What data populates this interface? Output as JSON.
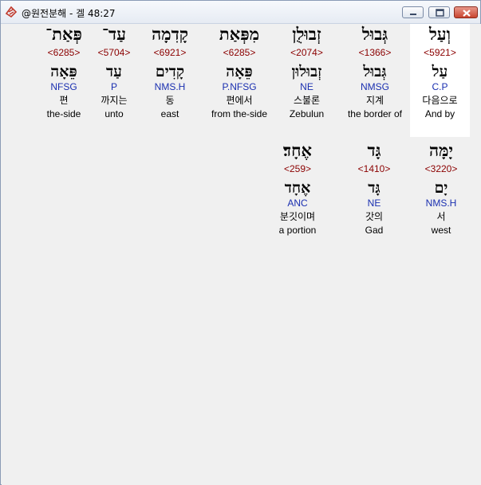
{
  "window": {
    "title": "@원전분해 - 겔 48:27",
    "icon": "app-logo-icon",
    "buttons": [
      "minimize-icon",
      "maximize-icon",
      "close-icon"
    ]
  },
  "colors": {
    "strong": "#8b0000",
    "morph": "#1a2fb0",
    "highlight_bg": "#ffffff",
    "content_bg": "#f0f0f0"
  },
  "words": [
    {
      "hebrew": "וְעַל",
      "strong": "<5921>",
      "lemma": "עַל",
      "morph": "C.P",
      "korean": "다음으로",
      "english": "And by"
    },
    {
      "hebrew": "גְּבוּל",
      "strong": "<1366>",
      "lemma": "גְּבוּל",
      "morph": "NMSG",
      "korean": "지계",
      "english": "the border of"
    },
    {
      "hebrew": "זְבוּלֻן",
      "strong": "<2074>",
      "lemma": "זְבוּלוּן",
      "morph": "NE",
      "korean": "스불론",
      "english": "Zebulun"
    },
    {
      "hebrew": "מִפְּאַת",
      "strong": "<6285>",
      "lemma": "פֵּאָה",
      "morph": "P.NFSG",
      "korean": "편에서",
      "english": "from the-side"
    },
    {
      "hebrew": "קָדִמָה",
      "strong": "<6921>",
      "lemma": "קָדִים",
      "morph": "NMS.H",
      "korean": "동",
      "english": "east"
    },
    {
      "hebrew": "עַד־",
      "strong": "<5704>",
      "lemma": "עַד",
      "morph": "P",
      "korean": "까지는",
      "english": "unto"
    },
    {
      "hebrew": "פְּאַת־",
      "strong": "<6285>",
      "lemma": "פֵּאָה",
      "morph": "NFSG",
      "korean": "편",
      "english": "the-side"
    },
    {
      "hebrew": "יָמָּה",
      "strong": "<3220>",
      "lemma": "יָם",
      "morph": "NMS.H",
      "korean": "서",
      "english": "west"
    },
    {
      "hebrew": "גָּד",
      "strong": "<1410>",
      "lemma": "גָּד",
      "morph": "NE",
      "korean": "갓의",
      "english": "Gad"
    },
    {
      "hebrew": "אֶחָד׃",
      "strong": "<259>",
      "lemma": "אֶחָד",
      "morph": "ANC",
      "korean": "분깃이며",
      "english": "a portion"
    }
  ]
}
